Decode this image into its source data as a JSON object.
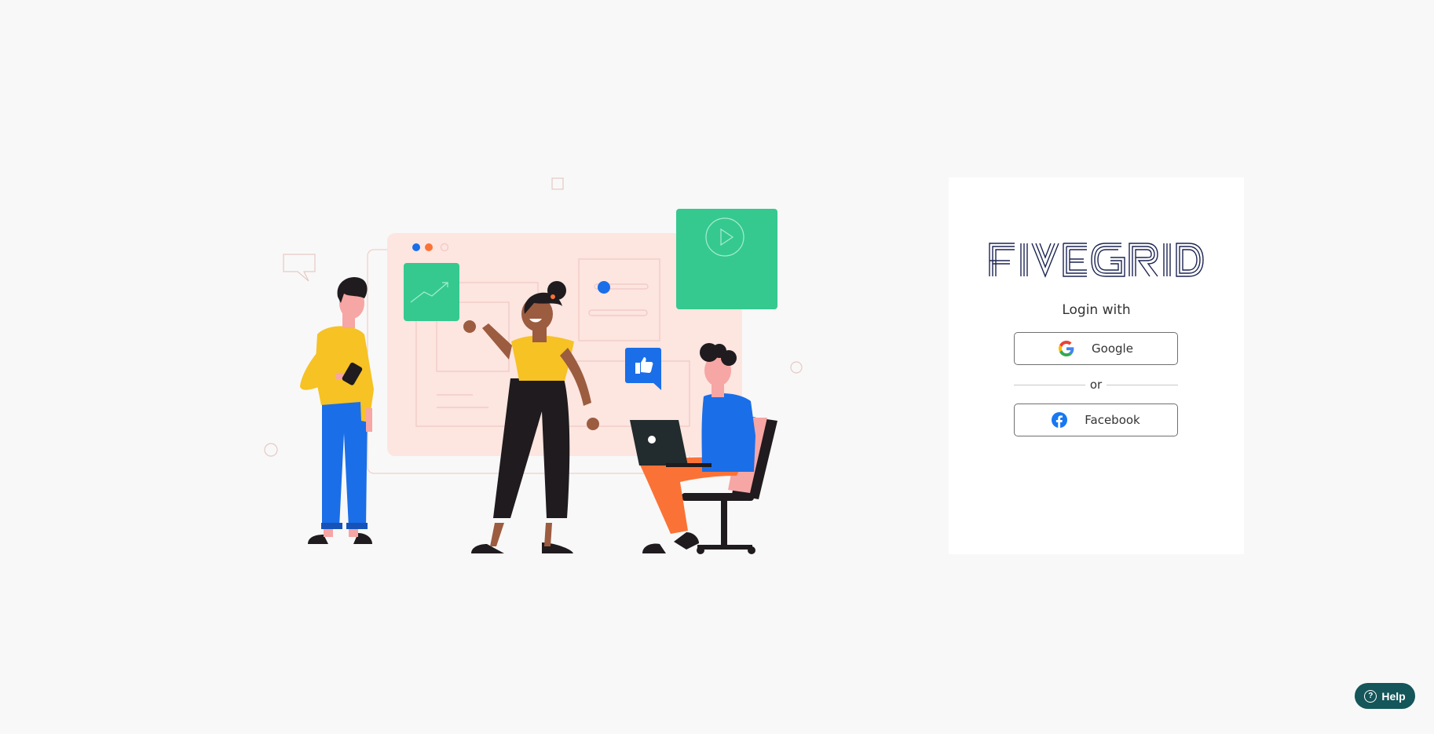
{
  "brand": {
    "logo_text": "FIVE GRID"
  },
  "login": {
    "title": "Login with",
    "google_label": "Google",
    "divider_text": "or",
    "facebook_label": "Facebook"
  },
  "help": {
    "label": "Help",
    "icon": "?"
  },
  "icons": {
    "google": "google-icon",
    "facebook": "facebook-icon",
    "help": "question-circle-icon"
  },
  "colors": {
    "background": "#f8f8f8",
    "card": "#ffffff",
    "logo": "#1c2452",
    "help": "#14565a",
    "facebook": "#1877f2",
    "illustration_green": "#35c98f",
    "illustration_blue": "#1a6ee8",
    "illustration_yellow": "#f6c224",
    "illustration_orange": "#fb7236",
    "illustration_pink_panel": "#fde5e0"
  }
}
